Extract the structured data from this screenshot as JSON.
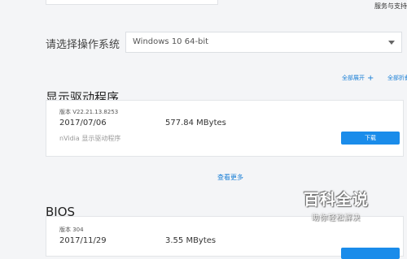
{
  "header": {
    "service_link": "服务与支持"
  },
  "os_selector": {
    "label": "请选择操作系统",
    "selected": "Windows 10 64-bit"
  },
  "drivers_section": {
    "title": "显示驱动程序",
    "expand_all": "全部展开",
    "collapse_all": "全部折叠",
    "items": [
      {
        "version_label": "版本 V22.21.13.8253",
        "date": "2017/07/06",
        "size": "577.84 MBytes",
        "description": "nVidia 显示驱动程序",
        "download_label": "下载"
      }
    ],
    "view_more": "查看更多"
  },
  "bios_section": {
    "title": "BIOS",
    "items": [
      {
        "version_label": "版本 304",
        "date": "2017/11/29",
        "size": "3.55 MBytes"
      }
    ]
  },
  "watermark": {
    "main": "百科全说",
    "sub": "助你轻松解决"
  },
  "colors": {
    "accent": "#1a8cea",
    "link": "#1a7fd6",
    "background": "#f4f5f7"
  }
}
